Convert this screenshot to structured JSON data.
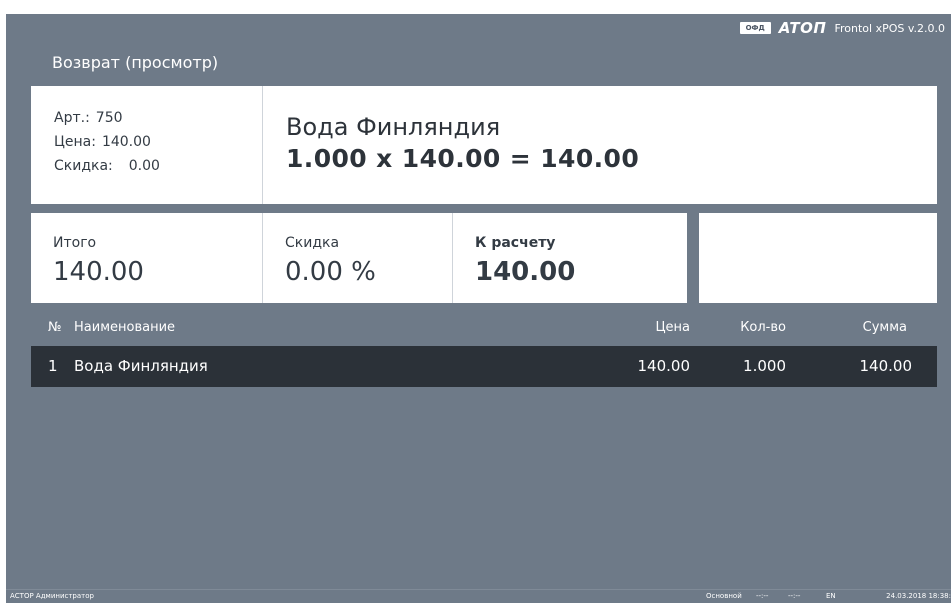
{
  "brand": {
    "ofd_badge": "ОФД",
    "logo_text": "ATOΠ",
    "version": "Frontol xPOS v.2.0.0"
  },
  "screen_title": "Возврат (просмотр)",
  "item": {
    "art_label": "Арт.:",
    "art_value": "750",
    "price_label": "Цена:",
    "price_value": "140.00",
    "discount_label": "Скидка:",
    "discount_value": "0.00",
    "name": "Вода Финляндия",
    "formula": "1.000 x 140.00 = 140.00"
  },
  "totals": {
    "total_label": "Итого",
    "total_value": "140.00",
    "discount_label": "Скидка",
    "discount_value": "0.00 %",
    "due_label": "К расчету",
    "due_value": "140.00"
  },
  "table": {
    "columns": {
      "no": "№",
      "name": "Наименование",
      "price": "Цена",
      "qty": "Кол-во",
      "sum": "Сумма"
    },
    "rows": [
      {
        "no": "1",
        "name": "Вода Финляндия",
        "price": "140.00",
        "qty": "1.000",
        "sum": "140.00"
      }
    ]
  },
  "status_bar": {
    "user": "АСТОР Администратор",
    "mode": "Основной",
    "dash1": "--:--",
    "dash2": "--:--",
    "lang": "EN",
    "datetime": "24.03.2018 18:38:"
  },
  "colors": {
    "background": "#6e7a88",
    "panel": "#ffffff",
    "selected_row": "#2b3138"
  }
}
